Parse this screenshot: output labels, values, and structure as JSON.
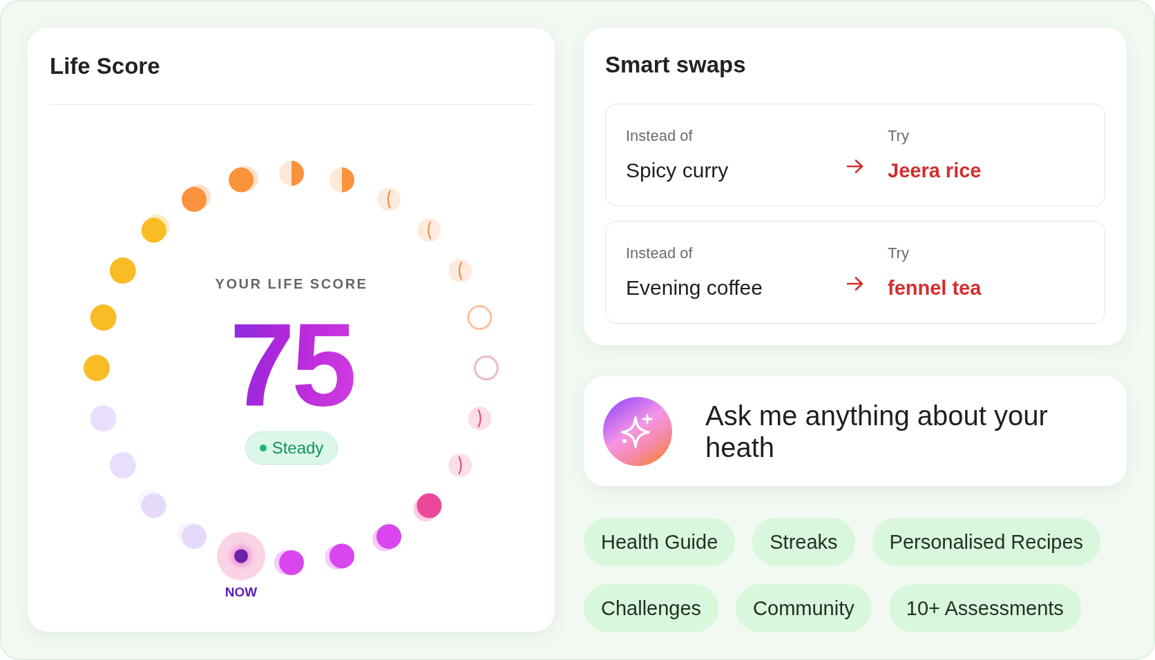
{
  "life_score": {
    "title": "Life Score",
    "score_label": "YOUR LIFE SCORE",
    "score": "75",
    "status": "Steady",
    "ring": [
      {
        "kind": "half",
        "color": "#fb923c"
      },
      {
        "kind": "half",
        "color": "#fb923c"
      },
      {
        "kind": "crescent",
        "color": "#fcebde"
      },
      {
        "kind": "crescent",
        "color": "#fcebde"
      },
      {
        "kind": "crescent",
        "color": "#fcebde"
      },
      {
        "kind": "ring",
        "color": "#f8c3a0"
      },
      {
        "kind": "ring",
        "color": "#f3b7cc"
      },
      {
        "kind": "crescent",
        "color": "#fadfe9"
      },
      {
        "kind": "crescent",
        "color": "#fadfe9"
      },
      {
        "kind": "fading",
        "color": "#ec4899"
      },
      {
        "kind": "fading",
        "color": "#d946ef"
      },
      {
        "kind": "fading",
        "color": "#d946ef"
      },
      {
        "kind": "fading",
        "color": "#d946ef"
      },
      {
        "kind": "now",
        "color": "#fbd3e6",
        "label": "NOW"
      },
      {
        "kind": "fading",
        "color": "#e6dafb"
      },
      {
        "kind": "fading",
        "color": "#e6dafb"
      },
      {
        "kind": "solid",
        "color": "#e9defb"
      },
      {
        "kind": "solid",
        "color": "#e9defb"
      },
      {
        "kind": "solid",
        "color": "#f9bc25"
      },
      {
        "kind": "solid",
        "color": "#f9bc25"
      },
      {
        "kind": "solid",
        "color": "#f9bc25"
      },
      {
        "kind": "fading",
        "color": "#f9bc25"
      },
      {
        "kind": "fading",
        "color": "#fb923c"
      },
      {
        "kind": "fading",
        "color": "#fb923c"
      }
    ]
  },
  "smart_swaps": {
    "title": "Smart swaps",
    "swaps": [
      {
        "from_label": "Instead of",
        "from": "Spicy curry",
        "to_label": "Try",
        "to": "Jeera rice"
      },
      {
        "from_label": "Instead of",
        "from": "Evening coffee",
        "to_label": "Try",
        "to": "fennel tea"
      }
    ]
  },
  "assistant": {
    "prompt": "Ask me anything about your heath"
  },
  "features": [
    "Health Guide",
    "Streaks",
    "Personalised Recipes",
    "Challenges",
    "Community",
    "10+ Assessments"
  ]
}
